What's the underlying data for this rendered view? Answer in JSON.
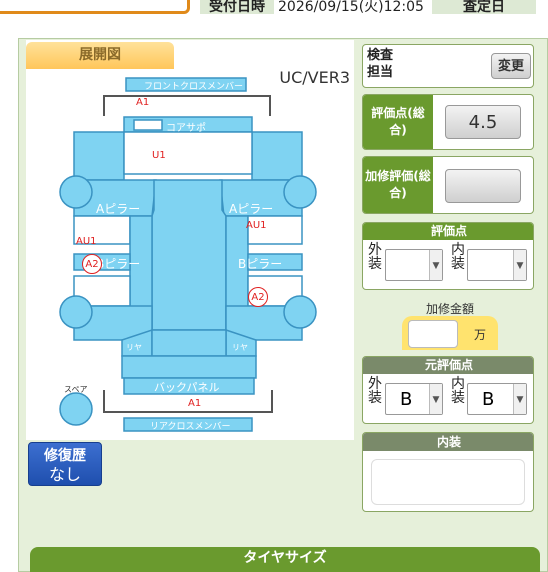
{
  "header": {
    "received_label": "受付日時",
    "received_value": "2026/09/15(火)12:05",
    "assessment_button": "査定日"
  },
  "diagram": {
    "tab_label": "展開図",
    "version": "UC/VER3",
    "part_labels": {
      "front_cross_member": "フロントクロスメンバー",
      "core_support": "コアサポ",
      "a_pillar_left": "Aピラー",
      "a_pillar_right": "Aピラー",
      "b_pillar_left": "Bピラー",
      "b_pillar_right": "Bピラー",
      "rear_left": "リヤ",
      "rear_right": "リヤ",
      "back_panel": "バックパネル",
      "rear_cross_member": "リアクロスメンバー",
      "spare": "スペア"
    },
    "damage_marks": {
      "front_a1": "A1",
      "hood_u1": "U1",
      "left_au1": "AU1",
      "right_au1": "AU1",
      "left_a2": "A2",
      "right_a2": "A2",
      "rear_a1": "A1"
    }
  },
  "repair_history": {
    "label": "修復歴",
    "value": "なし"
  },
  "inspector": {
    "label": "検査担当",
    "change_button": "変更"
  },
  "overall_score": {
    "label": "評価点(総合)",
    "value": "4.5"
  },
  "repair_rating": {
    "label": "加修評価(総合)",
    "value": ""
  },
  "score": {
    "title": "評価点",
    "exterior_label": "外装",
    "interior_label": "内装",
    "exterior_value": "",
    "interior_value": ""
  },
  "repair_amount": {
    "title": "加修金額",
    "unit": "万",
    "value": ""
  },
  "original_score": {
    "title": "元評価点",
    "exterior_label": "外装",
    "interior_label": "内装",
    "exterior_value": "B",
    "interior_value": "B"
  },
  "interior": {
    "title": "内装",
    "value": ""
  },
  "tire_size": {
    "title": "タイヤサイズ"
  },
  "colors": {
    "accent_green": "#6a9a2e",
    "diagram_blue": "#7fd3f2",
    "damage_red": "#e02020",
    "repair_blue": "#2a5cc0"
  }
}
